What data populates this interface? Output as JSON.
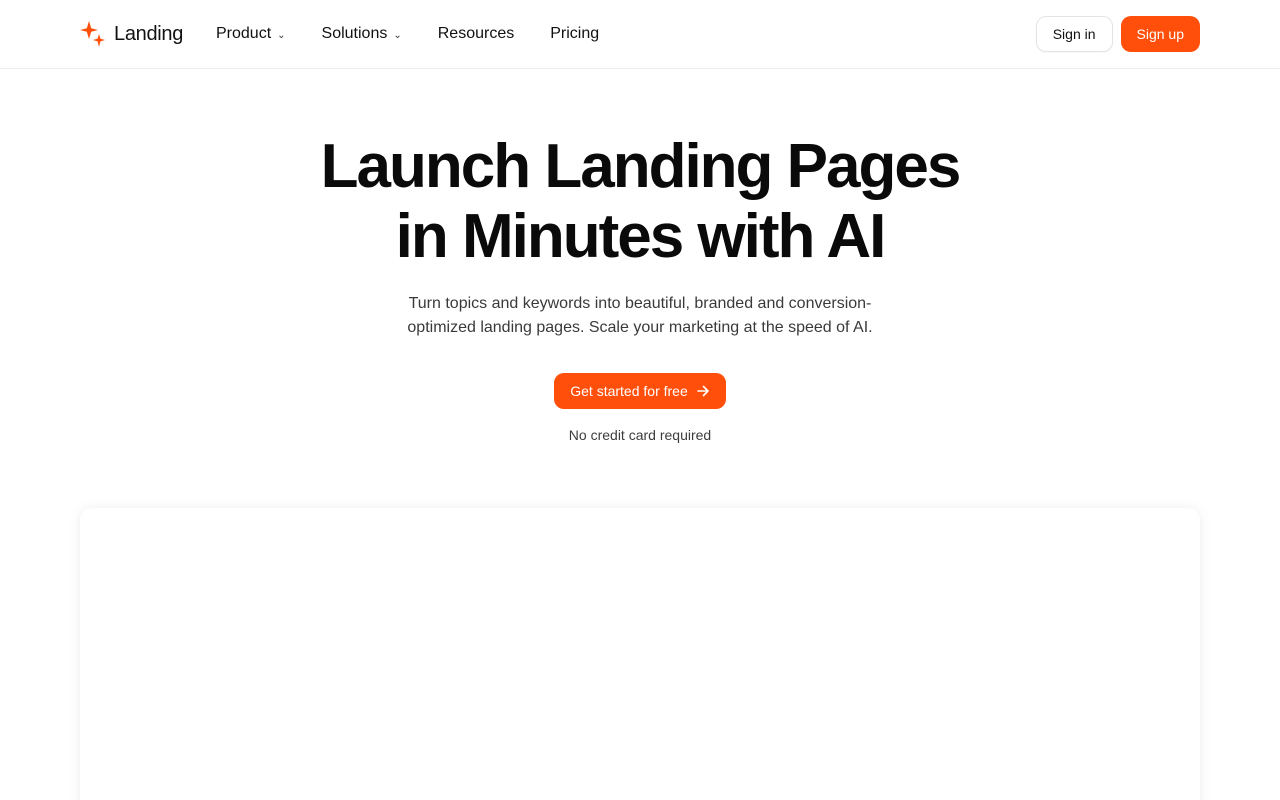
{
  "brand": {
    "name": "Landing",
    "accent_color": "#ff4f0a",
    "logo_icon": "sparkle-icon"
  },
  "nav": {
    "items": [
      {
        "label": "Product",
        "has_dropdown": true
      },
      {
        "label": "Solutions",
        "has_dropdown": true
      },
      {
        "label": "Resources",
        "has_dropdown": false
      },
      {
        "label": "Pricing",
        "has_dropdown": false
      }
    ],
    "dropdown_icon": "chevron-down-icon"
  },
  "auth": {
    "sign_in_label": "Sign in",
    "sign_up_label": "Sign up"
  },
  "hero": {
    "title_line_1": "Launch Landing Pages",
    "title_line_2": "in Minutes with AI",
    "subtitle": "Turn topics and keywords into beautiful, branded and conversion-optimized landing pages. Scale your marketing at the speed of AI.",
    "cta_label": "Get started for free",
    "cta_icon": "arrow-right-icon",
    "note": "No credit card required"
  }
}
